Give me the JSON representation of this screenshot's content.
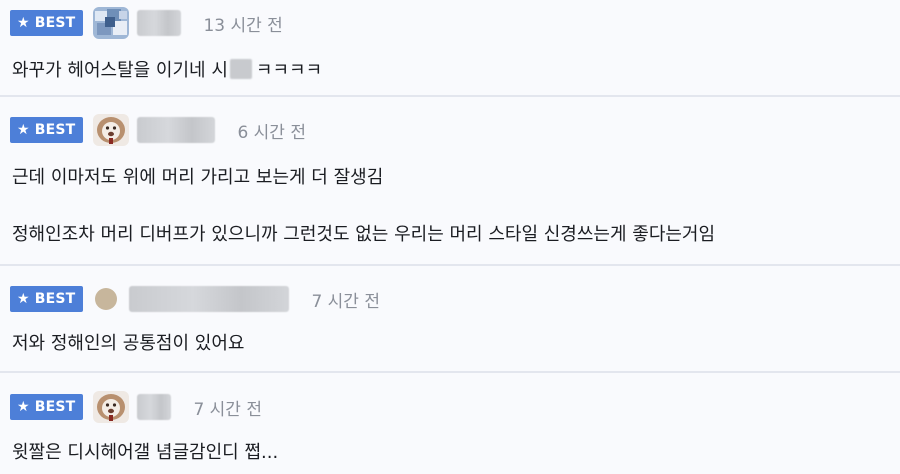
{
  "comments": [
    {
      "badge": "BEST",
      "time": "13 시간 전",
      "text_before": "와꾸가 헤어스탈을 이기네 시",
      "text_after": "ㅋㅋㅋㅋ"
    },
    {
      "badge": "BEST",
      "time": "6 시간 전",
      "line1": "근데 이마저도 위에 머리 가리고 보는게 더 잘생김",
      "line2": "정해인조차 머리 디버프가 있으니까 그런것도 없는 우리는 머리 스타일 신경쓰는게 좋다는거임"
    },
    {
      "badge": "BEST",
      "time": "7 시간 전",
      "text": "저와 정해인의 공통점이 있어요"
    },
    {
      "badge": "BEST",
      "time": "7 시간 전",
      "text": "윗짤은 디시헤어갤 념글감인디 쩝..."
    }
  ],
  "colors": {
    "badge": "#4d7fd8",
    "background": "#f9fafd",
    "divider": "#e3e6ee",
    "timestamp": "#8a8f99"
  },
  "icons": {
    "badge_icon": "star-icon"
  }
}
